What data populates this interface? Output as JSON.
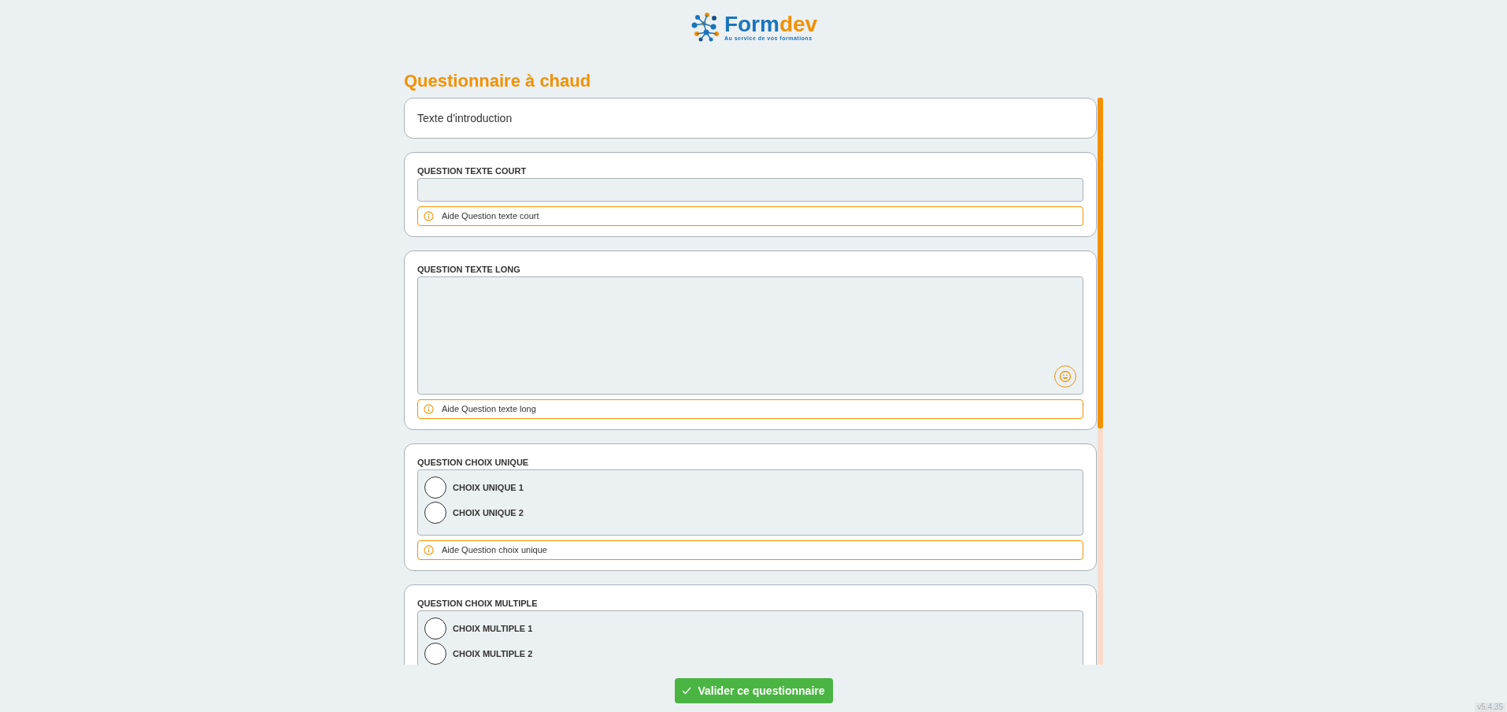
{
  "logo": {
    "name": "Formdev",
    "tagline": "Au service de vos formations"
  },
  "title": "Questionnaire à chaud",
  "intro": "Texte d'introduction",
  "questions": [
    {
      "kind": "text",
      "label": "QUESTION TEXTE COURT",
      "help": "Aide Question texte court"
    },
    {
      "kind": "textarea",
      "label": "QUESTION TEXTE LONG",
      "help": "Aide Question texte long"
    },
    {
      "kind": "choice",
      "label": "QUESTION CHOIX UNIQUE",
      "options": [
        {
          "label": "CHOIX UNIQUE 1",
          "selected": false
        },
        {
          "label": "CHOIX UNIQUE 2",
          "selected": false
        }
      ],
      "help": "Aide Question choix unique"
    },
    {
      "kind": "choice",
      "label": "QUESTION CHOIX MULTIPLE",
      "options": [
        {
          "label": "CHOIX MULTIPLE 1",
          "selected": false
        },
        {
          "label": "CHOIX MULTIPLE 2",
          "selected": false
        }
      ]
    }
  ],
  "submit": "Valider ce questionnaire",
  "version": "v5.4.35"
}
